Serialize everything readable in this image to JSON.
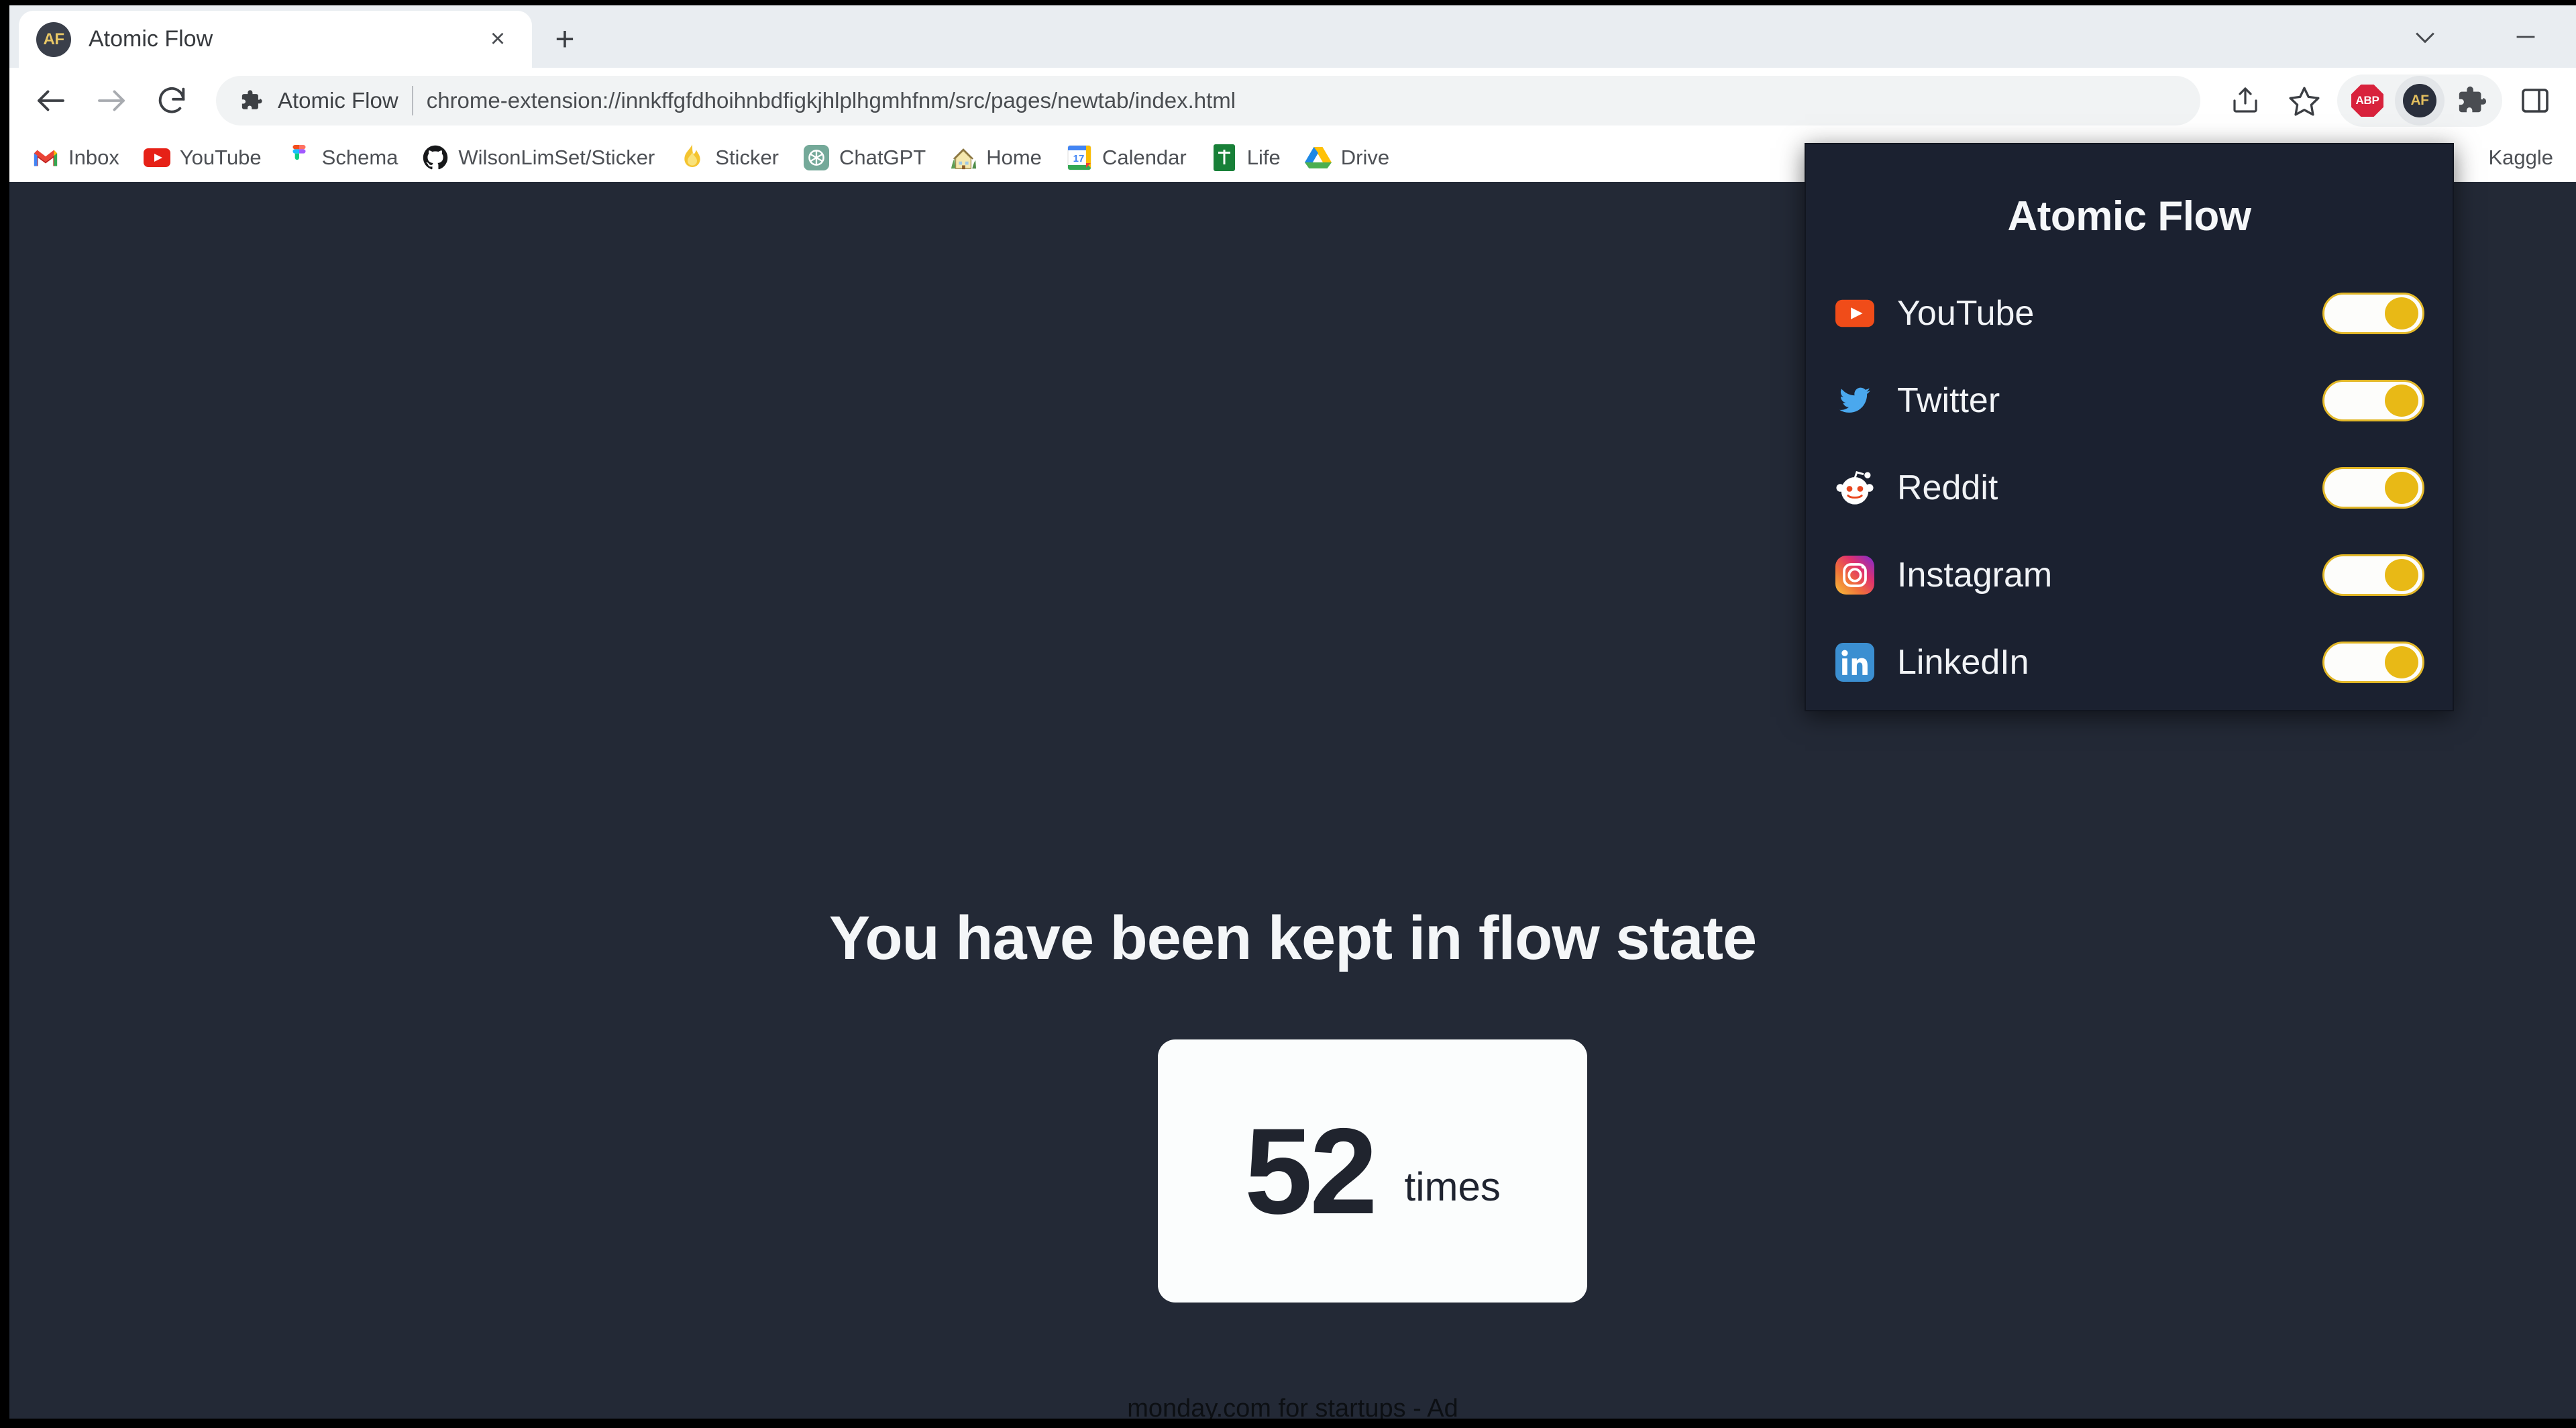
{
  "window": {
    "controls": [
      {
        "name": "tab-search-button",
        "icon": "chevron-down-icon"
      },
      {
        "name": "minimize-button",
        "icon": "minimize-icon"
      }
    ]
  },
  "tab_strip": {
    "tabs": [
      {
        "title": "Atomic Flow",
        "favicon": "AF",
        "close_label": "×",
        "active": true
      }
    ],
    "new_tab_label": "+"
  },
  "toolbar": {
    "back_icon": "back-arrow-icon",
    "forward_icon": "forward-arrow-icon",
    "reload_icon": "reload-icon",
    "omnibox": {
      "extension_icon": "puzzle-piece-icon",
      "extension_name": "Atomic Flow",
      "separator": "|",
      "url": "chrome-extension://innkffgfdhoihnbdfigkjhlplhgmhfnm/src/pages/newtab/index.html"
    },
    "share_icon": "share-icon",
    "bookmark_star_icon": "star-icon",
    "extensions": [
      {
        "name": "adblock-plus",
        "label": "ABP",
        "type": "badge-octagon",
        "color": "#d8223c"
      },
      {
        "name": "atomic-flow",
        "label": "AF",
        "type": "badge-circle",
        "color": "#2a2f3c",
        "active": true
      }
    ],
    "extensions_menu_icon": "puzzle-piece-icon",
    "side_panel_icon": "side-panel-icon"
  },
  "bookmarks_bar": {
    "items": [
      {
        "label": "Inbox",
        "icon": "gmail-icon"
      },
      {
        "label": "YouTube",
        "icon": "youtube-icon"
      },
      {
        "label": "Schema",
        "icon": "figma-icon"
      },
      {
        "label": "WilsonLimSet/Sticker",
        "icon": "github-icon"
      },
      {
        "label": "Sticker",
        "icon": "flame-icon"
      },
      {
        "label": "ChatGPT",
        "icon": "chatgpt-icon"
      },
      {
        "label": "Home",
        "icon": "house-icon"
      },
      {
        "label": "Calendar",
        "icon": "google-calendar-icon",
        "badge": "17"
      },
      {
        "label": "Life",
        "icon": "google-sheets-icon"
      },
      {
        "label": "Drive",
        "icon": "google-drive-icon"
      },
      {
        "label": "Kaggle",
        "icon": "kaggle-icon"
      }
    ]
  },
  "page": {
    "background_color": "#232936",
    "heading": "You have been kept in flow state",
    "count_card": {
      "number": "52",
      "unit": "times",
      "background_color": "#fbfdfd"
    },
    "ad_strip_text": "monday.com for startups - Ad"
  },
  "popup": {
    "title": "Atomic Flow",
    "background_color": "#1b2130",
    "accent_color": "#e8b916",
    "sites": [
      {
        "label": "YouTube",
        "icon": "youtube-icon",
        "toggle_state": "on"
      },
      {
        "label": "Twitter",
        "icon": "twitter-icon",
        "toggle_state": "on"
      },
      {
        "label": "Reddit",
        "icon": "reddit-icon",
        "toggle_state": "on"
      },
      {
        "label": "Instagram",
        "icon": "instagram-icon",
        "toggle_state": "on"
      },
      {
        "label": "LinkedIn",
        "icon": "linkedin-icon",
        "toggle_state": "on"
      }
    ]
  }
}
